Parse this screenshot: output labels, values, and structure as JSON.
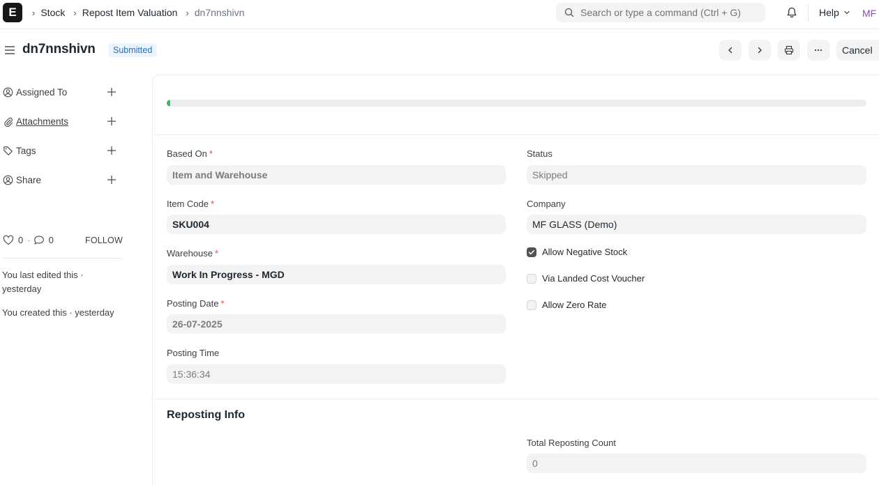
{
  "navbar": {
    "logo_letter": "E",
    "breadcrumbs": [
      "Stock",
      "Repost Item Valuation",
      "dn7nnshivn"
    ],
    "search_placeholder": "Search or type a command (Ctrl + G)",
    "help_label": "Help",
    "avatar_initials": "MF"
  },
  "page": {
    "title": "dn7nnshivn",
    "status_badge": "Submitted",
    "cancel_label": "Cancel"
  },
  "sidebar": {
    "items": [
      {
        "label": "Assigned To",
        "icon": "assign-user-icon"
      },
      {
        "label": "Attachments",
        "icon": "paperclip-icon"
      },
      {
        "label": "Tags",
        "icon": "tag-icon"
      },
      {
        "label": "Share",
        "icon": "share-user-icon"
      }
    ],
    "likes": "0",
    "comments": "0",
    "follow_label": "FOLLOW",
    "activity": {
      "last_edited": "You last edited this ·",
      "last_edited_when": "yesterday",
      "created": "You created this · yesterday"
    }
  },
  "form": {
    "progress_percent": 0.5,
    "based_on": {
      "label": "Based On",
      "value": "Item and Warehouse"
    },
    "item_code": {
      "label": "Item Code",
      "value": "SKU004"
    },
    "warehouse": {
      "label": "Warehouse",
      "value": "Work In Progress - MGD"
    },
    "posting_date": {
      "label": "Posting Date",
      "value": "26-07-2025"
    },
    "posting_time": {
      "label": "Posting Time",
      "value": "15:36:34"
    },
    "status": {
      "label": "Status",
      "value": "Skipped"
    },
    "company": {
      "label": "Company",
      "value": "MF GLASS (Demo)"
    },
    "checkboxes": [
      {
        "label": "Allow Negative Stock",
        "checked": true
      },
      {
        "label": "Via Landed Cost Voucher",
        "checked": false
      },
      {
        "label": "Allow Zero Rate",
        "checked": false
      }
    ],
    "reposting_section": {
      "title": "Reposting Info",
      "total_count_label": "Total Reposting Count",
      "total_count_value": "0"
    }
  },
  "colors": {
    "badge_bg": "#ebf5ff",
    "badge_text": "#1f70c1",
    "progress": "#3eb66b",
    "required": "#e24c4c",
    "avatar": "#9b3cc8"
  }
}
